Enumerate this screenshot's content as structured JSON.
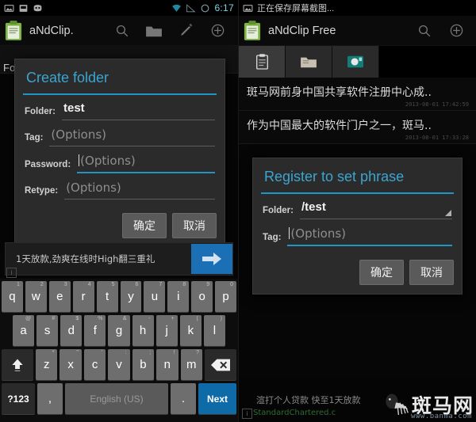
{
  "left": {
    "statusbar": {
      "icons": [
        "image-icon",
        "screenshot-icon",
        "cyanogen-icon",
        "wifi-icon",
        "signal-icon",
        "battery-icon"
      ],
      "time": "6:17"
    },
    "actionbar": {
      "app_icon": "clipboard-icon",
      "title": "aNdClip.",
      "buttons": [
        "search-icon",
        "folder-icon",
        "edit-icon",
        "add-icon"
      ]
    },
    "ghost_label": "Fold",
    "dialog": {
      "title": "Create folder",
      "rows": [
        {
          "label": "Folder:",
          "value": "test",
          "hint": "",
          "focused": false,
          "caret": false
        },
        {
          "label": "Tag:",
          "value": "",
          "hint": "(Options)",
          "focused": false,
          "caret": false
        },
        {
          "label": "Password:",
          "value": "",
          "hint": "(Options)",
          "focused": true,
          "caret": true
        },
        {
          "label": "Retype:",
          "value": "",
          "hint": "(Options)",
          "focused": false,
          "caret": false
        }
      ],
      "ok_label": "确定",
      "cancel_label": "取消"
    },
    "clip_strip": {
      "text": "1天放款,劲爽在线时High翻三重礼",
      "send_icon": "arrow-right-icon",
      "ad_badge": "i"
    },
    "keyboard": {
      "row1": [
        {
          "k": "q",
          "sup": "1"
        },
        {
          "k": "w",
          "sup": "2"
        },
        {
          "k": "e",
          "sup": "3"
        },
        {
          "k": "r",
          "sup": "4"
        },
        {
          "k": "t",
          "sup": "5"
        },
        {
          "k": "y",
          "sup": "6"
        },
        {
          "k": "u",
          "sup": "7"
        },
        {
          "k": "i",
          "sup": "8"
        },
        {
          "k": "o",
          "sup": "9"
        },
        {
          "k": "p",
          "sup": "0"
        }
      ],
      "row2": [
        {
          "k": "a",
          "sup": "@"
        },
        {
          "k": "s",
          "sup": "#"
        },
        {
          "k": "d",
          "sup": "$"
        },
        {
          "k": "f",
          "sup": "%"
        },
        {
          "k": "g",
          "sup": "&"
        },
        {
          "k": "h",
          "sup": "-"
        },
        {
          "k": "j",
          "sup": "+"
        },
        {
          "k": "k",
          "sup": "("
        },
        {
          "k": "l",
          "sup": ")"
        }
      ],
      "row3": [
        {
          "k": "z",
          "sup": "*"
        },
        {
          "k": "x",
          "sup": "\""
        },
        {
          "k": "c",
          "sup": "'"
        },
        {
          "k": "v",
          "sup": ":"
        },
        {
          "k": "b",
          "sup": ";"
        },
        {
          "k": "n",
          "sup": "!"
        },
        {
          "k": "m",
          "sup": "?"
        }
      ],
      "shift_label": "shift-icon",
      "backspace_label": "backspace-icon",
      "symbols_label": "?123",
      "comma_label": ",",
      "space_label": "English (US)",
      "period_label": ".",
      "enter_label": "Next"
    }
  },
  "right": {
    "statusbar": {
      "icon": "image-icon",
      "text": "正在保存屏幕截图..."
    },
    "actionbar": {
      "app_icon": "clipboard-icon",
      "title": "aNdClip Free",
      "buttons": [
        "search-icon",
        "add-icon"
      ]
    },
    "tabs": [
      {
        "name": "tab-clipboard",
        "icon": "clipboard-icon",
        "selected": true
      },
      {
        "name": "tab-folder",
        "icon": "folder-icon",
        "selected": false
      },
      {
        "name": "tab-phrase",
        "icon": "phrase-icon",
        "selected": false
      }
    ],
    "list": [
      {
        "text": "斑马网前身中国共享软件注册中心成..",
        "time": "2013-08-01 17:42:59"
      },
      {
        "text": "作为中国最大的软件门户之一，斑马..",
        "time": "2013-08-01 17:33:28"
      }
    ],
    "dialog": {
      "title": "Register to set phrase",
      "rows": [
        {
          "label": "Folder:",
          "value": "/test",
          "hint": "",
          "focused": false,
          "caret": false,
          "spinner": true
        },
        {
          "label": "Tag:",
          "value": "",
          "hint": "(Options)",
          "focused": true,
          "caret": true,
          "spinner": false
        }
      ],
      "ok_label": "确定",
      "cancel_label": "取消"
    },
    "ad": {
      "text": "渲打个人贷款 快至1天放款",
      "sub": "StandardChartered.c",
      "badge": "i",
      "watermark": "斑马网",
      "watermark_url": "www.banma.com"
    }
  },
  "colors": {
    "accent_blue": "#2196c4",
    "title_blue": "#3ba5d1",
    "enter_blue": "#0f6ba8",
    "send_blue": "#1b6fb5",
    "dialog_bg": "#2b2b2b",
    "key_gray": "#6e6e6e",
    "app_green": "#7cb342"
  }
}
